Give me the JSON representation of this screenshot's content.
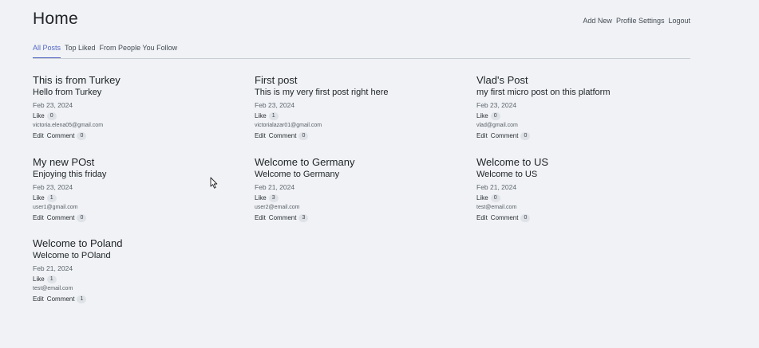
{
  "header": {
    "title": "Home",
    "links": [
      "Add New",
      "Profile Settings",
      "Logout"
    ]
  },
  "tabs": [
    {
      "label": "All Posts",
      "active": true
    },
    {
      "label": "Top Liked",
      "active": false
    },
    {
      "label": "From People You Follow",
      "active": false
    }
  ],
  "posts": [
    {
      "title": "This is from Turkey",
      "body": "Hello from Turkey",
      "date": "Feb 23, 2024",
      "like_label": "Like",
      "likes": "0",
      "email": "victoria.elena05@gmail.com",
      "edit_label": "Edit",
      "comment_label": "Comment",
      "comments": "0"
    },
    {
      "title": "First post",
      "body": "This is my very first post right here",
      "date": "Feb 23, 2024",
      "like_label": "Like",
      "likes": "1",
      "email": "victorialazar01@gmail.com",
      "edit_label": "Edit",
      "comment_label": "Comment",
      "comments": "0"
    },
    {
      "title": "Vlad's Post",
      "body": "my first micro post on this platform",
      "date": "Feb 23, 2024",
      "like_label": "Like",
      "likes": "0",
      "email": "vlad@gmail.com",
      "edit_label": "Edit",
      "comment_label": "Comment",
      "comments": "0"
    },
    {
      "title": "My new POst",
      "body": "Enjoying this friday",
      "date": "Feb 23, 2024",
      "like_label": "Like",
      "likes": "1",
      "email": "user1@gmail.com",
      "edit_label": "Edit",
      "comment_label": "Comment",
      "comments": "0"
    },
    {
      "title": "Welcome to Germany",
      "body": "Welcome to Germany",
      "date": "Feb 21, 2024",
      "like_label": "Like",
      "likes": "3",
      "email": "user2@email.com",
      "edit_label": "Edit",
      "comment_label": "Comment",
      "comments": "3"
    },
    {
      "title": "Welcome to US",
      "body": "Welcome to US",
      "date": "Feb 21, 2024",
      "like_label": "Like",
      "likes": "0",
      "email": "test@email.com",
      "edit_label": "Edit",
      "comment_label": "Comment",
      "comments": "0"
    },
    {
      "title": "Welcome to Poland",
      "body": "Welcome to POland",
      "date": "Feb 21, 2024",
      "like_label": "Like",
      "likes": "1",
      "email": "test@email.com",
      "edit_label": "Edit",
      "comment_label": "Comment",
      "comments": "1"
    }
  ],
  "colors": {
    "background": "#f0f2f5",
    "active_tab": "#5468c6",
    "badge_bg": "#dfe3e8"
  },
  "icons": {
    "cursor": "mouse-pointer-icon"
  }
}
